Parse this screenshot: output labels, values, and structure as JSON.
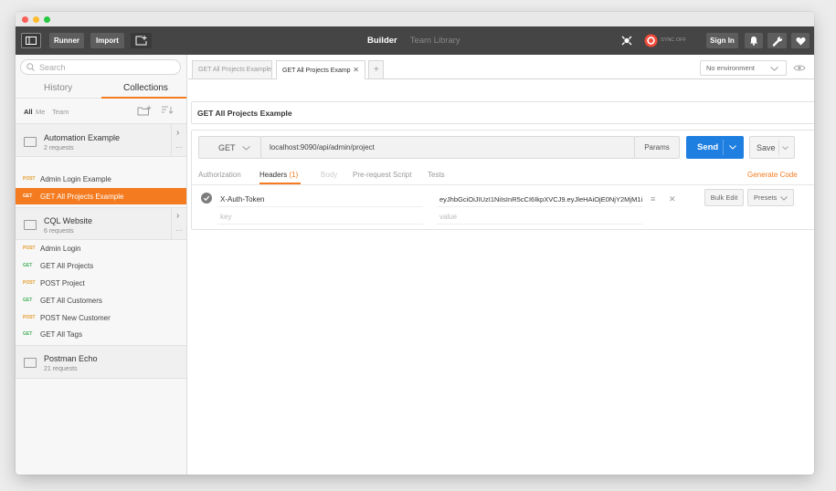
{
  "toolbar": {
    "runner": "Runner",
    "import": "Import",
    "tab_builder": "Builder",
    "tab_team_library": "Team Library",
    "sync": "SYNC OFF",
    "sign_in": "Sign In"
  },
  "sidebar": {
    "search_placeholder": "Search",
    "tab_history": "History",
    "tab_collections": "Collections",
    "filter_all": "All",
    "filter_me": "Me",
    "filter_team": "Team",
    "collections": [
      {
        "name": "Automation Example",
        "count": "2 requests"
      },
      {
        "name": "CQL Website",
        "count": "6 requests"
      },
      {
        "name": "Postman Echo",
        "count": "21 requests"
      }
    ],
    "requests": [
      {
        "method": "POST",
        "name": "Admin Login Example"
      },
      {
        "method": "GET",
        "name": "GET All Projects Example"
      },
      {
        "method": "POST",
        "name": "Admin Login"
      },
      {
        "method": "GET",
        "name": "GET All Projects"
      },
      {
        "method": "POST",
        "name": "POST Project"
      },
      {
        "method": "GET",
        "name": "GET All Customers"
      },
      {
        "method": "POST",
        "name": "POST New Customer"
      },
      {
        "method": "GET",
        "name": "GET All Tags"
      }
    ]
  },
  "tabs": {
    "tab1": "GET All Projects Example",
    "tab2": "GET All Projects Examp",
    "environment": "No environment"
  },
  "request": {
    "name": "GET All Projects Example",
    "method": "GET",
    "url": "localhost:9090/api/admin/project",
    "params": "Params",
    "send": "Send",
    "save": "Save"
  },
  "subtabs": {
    "authorization": "Authorization",
    "headers": "Headers",
    "headers_count": "(1)",
    "body": "Body",
    "prerequest": "Pre-request Script",
    "tests": "Tests",
    "generate_code": "Generate Code"
  },
  "headers": {
    "key": "X-Auth-Token",
    "value": "eyJhbGciOiJIUzI1NiIsInR5cCI6IkpXVCJ9.eyJleHAiOjE0NjY2MjM1i",
    "key_placeholder": "key",
    "value_placeholder": "value",
    "bulk_edit": "Bulk Edit",
    "presets": "Presets"
  },
  "colors": {
    "accent": "#f47b20",
    "send": "#1f7fe0",
    "get": "#45b05b",
    "post": "#e39d2c"
  }
}
